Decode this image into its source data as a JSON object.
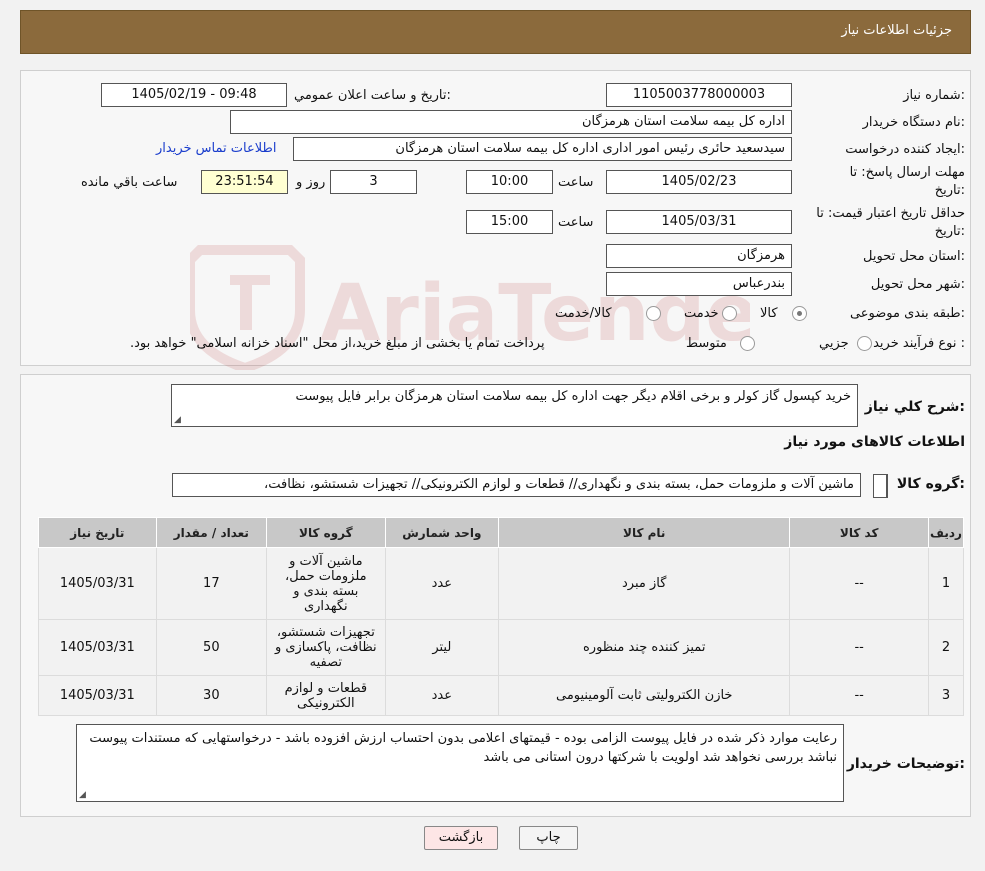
{
  "header": {
    "title": "جزئیات اطلاعات نیاز"
  },
  "form": {
    "need_number_label": "شماره نیاز:",
    "need_number": "1105003778000003",
    "announce_label": "تاریخ و ساعت اعلان عمومي:",
    "announce_value": "1405/02/19 - 09:48",
    "buyer_label": "نام دستگاه خریدار:",
    "buyer_value": "اداره کل بیمه سلامت استان هرمزگان",
    "creator_label": "ایجاد کننده درخواست:",
    "creator_value": "سیدسعید حائری رئیس امور اداری اداره کل بیمه سلامت استان هرمزگان",
    "contact_link": "اطلاعات تماس خریدار",
    "deadline_label_1": "مهلت ارسال پاسخ: تا",
    "deadline_label_2": "تاریخ:",
    "deadline_date": "1405/02/23",
    "time_label": "ساعت",
    "deadline_time": "10:00",
    "days_value": "3",
    "days_label": "روز و",
    "remaining_value": "23:51:54",
    "remaining_label": "ساعت باقي مانده",
    "validity_label_1": "حداقل تاریخ اعتبار قیمت: تا",
    "validity_label_2": "تاریخ:",
    "validity_date": "1405/03/31",
    "validity_time": "15:00",
    "province_label": "استان محل تحویل:",
    "province_value": "هرمزگان",
    "city_label": "شهر محل تحویل:",
    "city_value": "بندرعباس",
    "category_label": "طبقه بندی موضوعی:",
    "category_options": [
      "کالا",
      "خدمت",
      "کالا/خدمت"
    ],
    "process_label": "نوع فرآیند خرید :",
    "process_options": [
      "جزیي",
      "متوسط"
    ],
    "process_note": "پرداخت تمام یا بخشی از مبلغ خرید،از محل \"اسناد خزانه اسلامی\" خواهد بود."
  },
  "details": {
    "summary_label": "شرح کلي نیاز:",
    "summary_value": "خرید کپسول گاز کولر و برخی اقلام دیگر جهت اداره کل بیمه سلامت استان هرمزگان برابر فایل پیوست",
    "items_title": "اطلاعات کالاهای مورد نیاز",
    "group_label": "گروه کالا:",
    "group_value": "ماشین آلات و ملزومات حمل، بسته بندی و نگهداری// قطعات و لوازم الکترونیکی// تجهیزات شستشو، نظافت،"
  },
  "table": {
    "headers": [
      "ردیف",
      "کد کالا",
      "نام کالا",
      "واحد شمارش",
      "گروه کالا",
      "تعداد / مقدار",
      "تاریخ نیاز"
    ],
    "rows": [
      [
        "1",
        "--",
        "گاز مبرد",
        "عدد",
        "ماشین آلات و ملزومات حمل، بسته بندی و نگهداری",
        "17",
        "1405/03/31"
      ],
      [
        "2",
        "--",
        "تمیز کننده چند منظوره",
        "لیتر",
        "تجهیزات شستشو، نظافت، پاکسازی و تصفیه",
        "50",
        "1405/03/31"
      ],
      [
        "3",
        "--",
        "خازن الکترولیتی ثابت آلومینیومی",
        "عدد",
        "قطعات و لوازم الکترونیکی",
        "30",
        "1405/03/31"
      ]
    ]
  },
  "notes": {
    "label": "توضیحات خریدار:",
    "value": "رعایت موارد ذکر شده در فایل پیوست الزامی بوده - قیمتهای اعلامی بدون احتساب ارزش افزوده باشد - درخواستهایی که مستندات پیوست نباشد بررسی نخواهد شد اولویت با شرکتها درون استانی می باشد"
  },
  "buttons": {
    "print": "چاپ",
    "back": "بازگشت"
  },
  "watermark": {
    "text": "AriaTender.neT"
  },
  "colors": {
    "header": "#8b6a3c",
    "link": "#1a3dcc",
    "back_button": "#fde6e6",
    "yellow_box": "#ffffd2"
  }
}
